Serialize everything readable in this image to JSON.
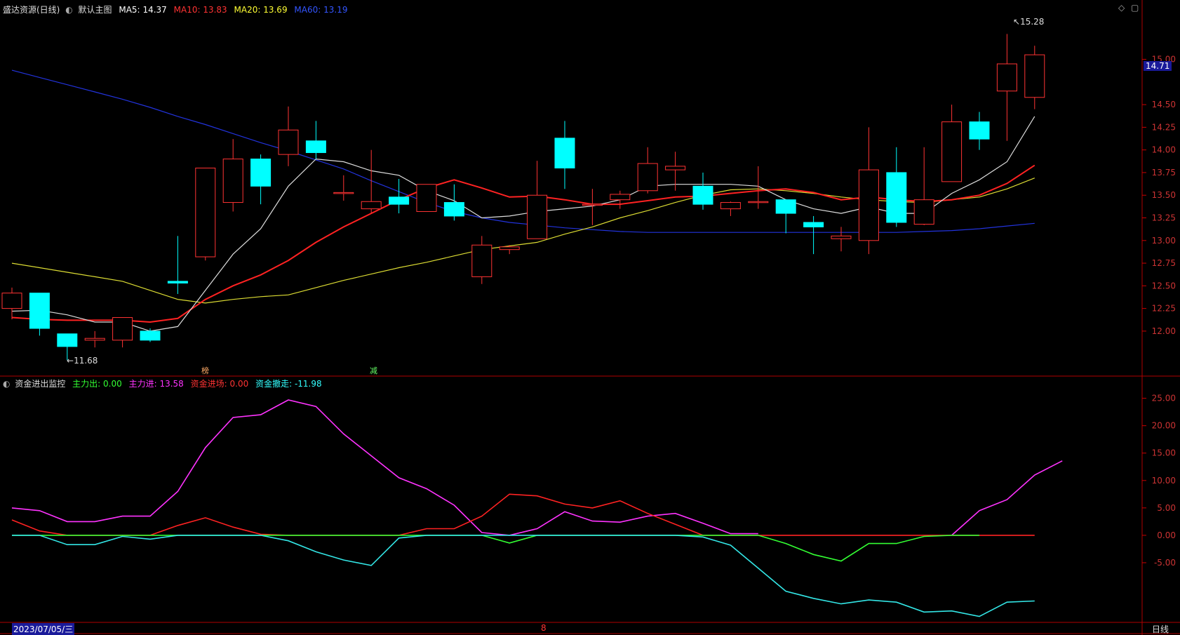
{
  "header": {
    "stock_label": "盛达资源(日线)",
    "template_label": "默认主图",
    "ma": [
      {
        "label": "MA5:",
        "value": "14.37",
        "color": "#ffffff"
      },
      {
        "label": "MA10:",
        "value": "13.83",
        "color": "#ff3333"
      },
      {
        "label": "MA20:",
        "value": "13.69",
        "color": "#ffff33"
      },
      {
        "label": "MA60:",
        "value": "13.19",
        "color": "#3355ff"
      }
    ]
  },
  "indicator_header": {
    "title": "资金进出监控",
    "items": [
      {
        "label": "主力出:",
        "value": "0.00",
        "color": "#33ff33"
      },
      {
        "label": "主力进:",
        "value": "13.58",
        "color": "#ff33ff"
      },
      {
        "label": "资金进场:",
        "value": "0.00",
        "color": "#ff3333"
      },
      {
        "label": "资金撤走:",
        "value": "-11.98",
        "color": "#33ffff"
      }
    ]
  },
  "footer": {
    "date_label": "2023/07/05/三",
    "marker": "8",
    "period_button": "日线"
  },
  "price_badge": "14.71",
  "annotations": {
    "high_label": "15.28",
    "low_label": "11.68",
    "mark_bang": "榜",
    "mark_jian": "减"
  },
  "colors": {
    "up": "#ff3333",
    "down": "#00ffff",
    "ma5": "#dddddd",
    "ma10": "#ff2222",
    "ma20": "#dddd33",
    "ma60": "#2233dd",
    "axis": "#cc0000",
    "grid_text": "#cc3333"
  },
  "chart_data": [
    {
      "type": "candlestick",
      "ylim": [
        11.55,
        15.5
      ],
      "y_ticks": [
        12.0,
        12.25,
        12.5,
        12.75,
        13.0,
        13.25,
        13.5,
        13.75,
        14.0,
        14.25,
        14.5,
        15.0
      ],
      "candles": [
        {
          "o": 12.25,
          "h": 12.48,
          "l": 12.13,
          "c": 12.42
        },
        {
          "o": 12.42,
          "h": 12.42,
          "l": 11.95,
          "c": 12.03
        },
        {
          "o": 11.97,
          "h": 11.97,
          "l": 11.68,
          "c": 11.83
        },
        {
          "o": 11.9,
          "h": 12.0,
          "l": 11.82,
          "c": 11.92
        },
        {
          "o": 11.9,
          "h": 12.15,
          "l": 11.82,
          "c": 12.15
        },
        {
          "o": 12.0,
          "h": 12.03,
          "l": 11.88,
          "c": 11.9
        },
        {
          "o": 12.55,
          "h": 13.05,
          "l": 12.41,
          "c": 12.53
        },
        {
          "o": 12.82,
          "h": 13.8,
          "l": 12.78,
          "c": 13.8
        },
        {
          "o": 13.42,
          "h": 14.12,
          "l": 13.32,
          "c": 13.9
        },
        {
          "o": 13.9,
          "h": 13.95,
          "l": 13.4,
          "c": 13.6
        },
        {
          "o": 13.95,
          "h": 14.48,
          "l": 13.82,
          "c": 14.22
        },
        {
          "o": 14.1,
          "h": 14.32,
          "l": 13.9,
          "c": 13.97
        },
        {
          "o": 13.53,
          "h": 13.72,
          "l": 13.44,
          "c": 13.53
        },
        {
          "o": 13.35,
          "h": 14.0,
          "l": 13.3,
          "c": 13.43
        },
        {
          "o": 13.48,
          "h": 13.68,
          "l": 13.3,
          "c": 13.4
        },
        {
          "o": 13.32,
          "h": 13.62,
          "l": 13.32,
          "c": 13.62
        },
        {
          "o": 13.42,
          "h": 13.62,
          "l": 13.22,
          "c": 13.27
        },
        {
          "o": 12.6,
          "h": 13.05,
          "l": 12.52,
          "c": 12.95
        },
        {
          "o": 12.9,
          "h": 12.95,
          "l": 12.85,
          "c": 12.93
        },
        {
          "o": 13.02,
          "h": 13.88,
          "l": 13.02,
          "c": 13.5
        },
        {
          "o": 14.13,
          "h": 14.32,
          "l": 13.57,
          "c": 13.8
        },
        {
          "o": 13.4,
          "h": 13.57,
          "l": 13.17,
          "c": 13.4
        },
        {
          "o": 13.45,
          "h": 13.55,
          "l": 13.35,
          "c": 13.51
        },
        {
          "o": 13.55,
          "h": 14.03,
          "l": 13.52,
          "c": 13.85
        },
        {
          "o": 13.78,
          "h": 13.98,
          "l": 13.55,
          "c": 13.82
        },
        {
          "o": 13.6,
          "h": 13.75,
          "l": 13.34,
          "c": 13.4
        },
        {
          "o": 13.35,
          "h": 13.43,
          "l": 13.27,
          "c": 13.42
        },
        {
          "o": 13.43,
          "h": 13.82,
          "l": 13.35,
          "c": 13.43
        },
        {
          "o": 13.45,
          "h": 13.45,
          "l": 13.08,
          "c": 13.3
        },
        {
          "o": 13.2,
          "h": 13.27,
          "l": 12.85,
          "c": 13.15
        },
        {
          "o": 13.02,
          "h": 13.15,
          "l": 12.88,
          "c": 13.05
        },
        {
          "o": 13.0,
          "h": 14.25,
          "l": 12.85,
          "c": 13.78
        },
        {
          "o": 13.75,
          "h": 14.03,
          "l": 13.15,
          "c": 13.2
        },
        {
          "o": 13.18,
          "h": 14.03,
          "l": 13.17,
          "c": 13.45
        },
        {
          "o": 13.65,
          "h": 14.5,
          "l": 13.65,
          "c": 14.31
        },
        {
          "o": 14.31,
          "h": 14.42,
          "l": 14.0,
          "c": 14.12
        },
        {
          "o": 14.65,
          "h": 15.28,
          "l": 14.1,
          "c": 14.95
        },
        {
          "o": 14.58,
          "h": 15.15,
          "l": 14.45,
          "c": 15.05
        }
      ],
      "ma5": [
        12.22,
        12.23,
        12.18,
        12.1,
        12.1,
        12.0,
        12.05,
        12.45,
        12.85,
        13.13,
        13.6,
        13.9,
        13.87,
        13.77,
        13.72,
        13.55,
        13.44,
        13.25,
        13.27,
        13.32,
        13.35,
        13.38,
        13.45,
        13.6,
        13.62,
        13.62,
        13.62,
        13.6,
        13.45,
        13.35,
        13.3,
        13.37,
        13.3,
        13.3,
        13.52,
        13.67,
        13.87,
        14.37
      ],
      "ma10": [
        12.15,
        12.13,
        12.12,
        12.12,
        12.12,
        12.1,
        12.14,
        12.35,
        12.5,
        12.62,
        12.78,
        12.98,
        13.15,
        13.3,
        13.45,
        13.58,
        13.67,
        13.58,
        13.48,
        13.49,
        13.45,
        13.4,
        13.4,
        13.44,
        13.48,
        13.49,
        13.52,
        13.55,
        13.57,
        13.53,
        13.45,
        13.48,
        13.45,
        13.43,
        13.45,
        13.5,
        13.63,
        13.83
      ],
      "ma20": [
        12.75,
        12.7,
        12.65,
        12.6,
        12.55,
        12.45,
        12.35,
        12.31,
        12.35,
        12.38,
        12.4,
        12.48,
        12.56,
        12.63,
        12.7,
        12.76,
        12.83,
        12.9,
        12.94,
        12.98,
        13.07,
        13.15,
        13.25,
        13.33,
        13.42,
        13.5,
        13.56,
        13.57,
        13.55,
        13.52,
        13.48,
        13.45,
        13.43,
        13.42,
        13.45,
        13.48,
        13.57,
        13.69
      ],
      "ma60": [
        14.88,
        14.8,
        14.72,
        14.64,
        14.56,
        14.47,
        14.37,
        14.28,
        14.18,
        14.08,
        13.99,
        13.89,
        13.79,
        13.66,
        13.54,
        13.42,
        13.32,
        13.25,
        13.2,
        13.17,
        13.14,
        13.12,
        13.1,
        13.09,
        13.09,
        13.09,
        13.09,
        13.09,
        13.09,
        13.09,
        13.09,
        13.09,
        13.09,
        13.1,
        13.11,
        13.13,
        13.16,
        13.19
      ]
    },
    {
      "type": "line",
      "ylim": [
        -15.5,
        27.0
      ],
      "y_ticks": [
        25.0,
        20.0,
        15.0,
        10.0,
        5.0,
        0.0,
        -5.0
      ],
      "series": [
        {
          "name": "主力进",
          "color": "#ff33ff",
          "values": [
            5.0,
            4.5,
            2.5,
            2.5,
            3.5,
            3.5,
            8.0,
            16.0,
            21.5,
            22.0,
            24.7,
            23.5,
            18.5,
            14.5,
            10.5,
            8.5,
            5.5,
            0.5,
            0.0,
            1.2,
            4.3,
            2.6,
            2.4,
            3.5,
            4.0,
            2.2,
            0.3,
            0.3,
            null,
            null,
            null,
            null,
            null,
            null,
            0.0,
            4.5,
            6.5,
            11.0,
            13.58
          ]
        },
        {
          "name": "资金进场",
          "color": "#ff2222",
          "values": [
            2.8,
            0.8,
            0.0,
            0.0,
            0.0,
            0.0,
            1.8,
            3.2,
            1.5,
            0.2,
            0.0,
            0.0,
            0.0,
            0.0,
            0.0,
            1.2,
            1.2,
            3.5,
            7.5,
            7.2,
            5.7,
            5.0,
            6.3,
            4.0,
            2.0,
            0.0,
            0.0,
            0.0,
            0.0,
            0.0,
            0.0,
            0.0,
            0.0,
            0.0,
            0.0,
            0.0,
            0.0,
            0.0
          ]
        },
        {
          "name": "主力出",
          "color": "#33ff33",
          "values": [
            0.0,
            0.0,
            0.0,
            0.0,
            0.0,
            0.0,
            0.0,
            0.0,
            0.0,
            0.0,
            0.0,
            0.0,
            0.0,
            0.0,
            0.0,
            0.0,
            0.0,
            0.0,
            -1.4,
            0.0,
            0.0,
            0.0,
            0.0,
            0.0,
            0.0,
            0.0,
            0.0,
            0.0,
            -1.5,
            -3.5,
            -4.7,
            -1.5,
            -1.5,
            -0.2,
            0.0,
            0.0
          ]
        },
        {
          "name": "资金撤走",
          "color": "#33e6e6",
          "values": [
            0.0,
            0.0,
            -1.7,
            -1.7,
            -0.2,
            -0.7,
            0.0,
            0.0,
            0.0,
            0.0,
            -1.0,
            -3.0,
            -4.5,
            -5.5,
            -0.5,
            0.0,
            0.0,
            0.0,
            0.0,
            0.0,
            0.0,
            0.0,
            0.0,
            0.0,
            0.0,
            -0.3,
            -1.8,
            -6.0,
            -10.2,
            -11.5,
            -12.5,
            -11.8,
            -12.2,
            -14.0,
            -13.8,
            -14.8,
            -12.2,
            -11.98
          ]
        }
      ]
    }
  ]
}
